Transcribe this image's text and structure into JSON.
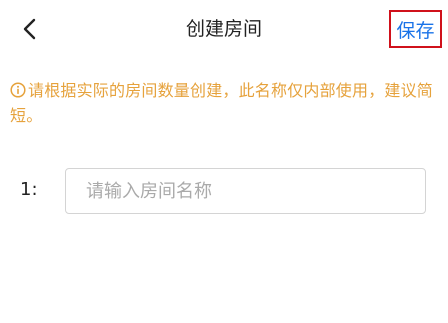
{
  "header": {
    "back_icon": "chevron-left-icon",
    "title": "创建房间",
    "save_label": "保存",
    "save_highlight_color": "#d0111b",
    "save_text_color": "#1a73e8"
  },
  "notice": {
    "icon": "info-circle-icon",
    "text": "请根据实际的房间数量创建，此名称仅内部使用，建议简短。",
    "color": "#e6a23c"
  },
  "rooms": [
    {
      "label": "1:",
      "value": "",
      "placeholder": "请输入房间名称"
    }
  ]
}
